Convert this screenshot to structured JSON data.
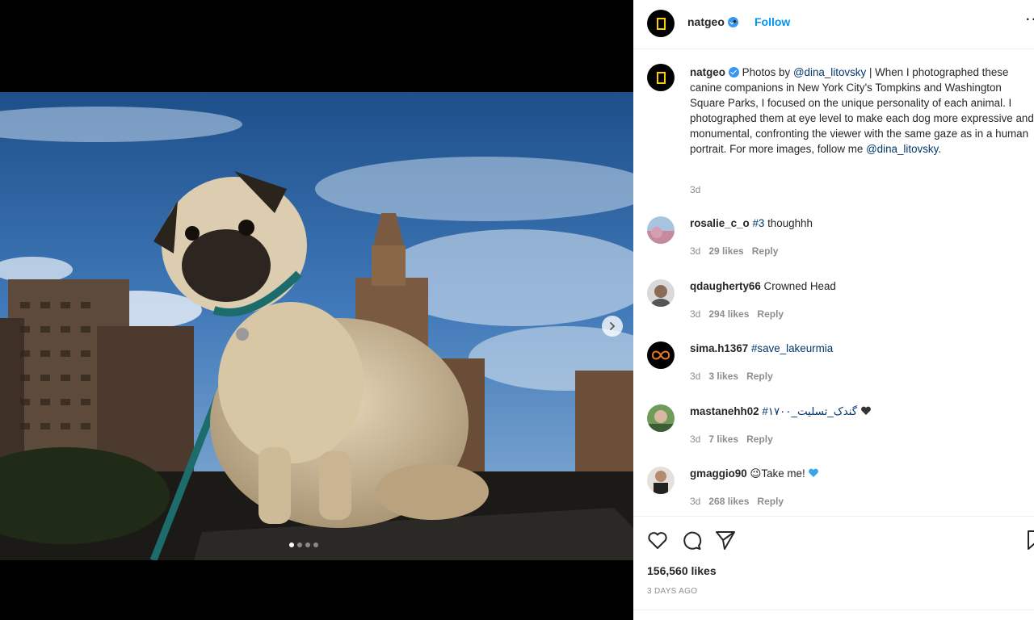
{
  "post": {
    "author": "natgeo",
    "follow_label": "Follow",
    "separator": "•",
    "more_label": "···",
    "caption": {
      "author": "natgeo",
      "intro": "Photos by",
      "mention1": "@dina_litovsky",
      "body": "| When I photographed these canine companions in New York City's Tompkins and Washington Square Parks, I focused on the unique personality of each animal. I photographed them at eye level to make each dog more expressive and monumental, confronting the viewer with the same gaze as in a human portrait. For more images, follow me",
      "mention2": "@dina_litovsky",
      "end": ".",
      "time": "3d"
    },
    "comments": [
      {
        "user": "rosalie_c_o",
        "hashtag": "#3",
        "text": "thoughhh",
        "time": "3d",
        "likes": "29 likes",
        "reply": "Reply"
      },
      {
        "user": "qdaugherty66",
        "text": "Crowned Head",
        "time": "3d",
        "likes": "294 likes",
        "reply": "Reply"
      },
      {
        "user": "sima.h1367",
        "hashtag": "#save_lakeurmia",
        "time": "3d",
        "likes": "3 likes",
        "reply": "Reply"
      },
      {
        "user": "mastanehh02",
        "hashtag": "#۱۷۰۰_گندک_تسلیت",
        "time": "3d",
        "likes": "7 likes",
        "reply": "Reply"
      },
      {
        "user": "gmaggio90",
        "emoji": "😉",
        "text": "Take me!",
        "time": "3d",
        "likes": "268 likes",
        "reply": "Reply"
      }
    ],
    "likes_count": "156,560 likes",
    "posted_ago": "3 DAYS AGO"
  },
  "carousel": {
    "slides": 4,
    "active": 1
  },
  "icons": {
    "like": "heart-icon",
    "comment": "comment-icon",
    "share": "share-icon",
    "save": "bookmark-icon",
    "next": "chevron-right-icon",
    "verified": "verified-badge-icon"
  },
  "colors": {
    "link": "#0095f6",
    "mention": "#00376b",
    "muted": "#8e8e8e",
    "brand_yellow": "#ffce00"
  }
}
